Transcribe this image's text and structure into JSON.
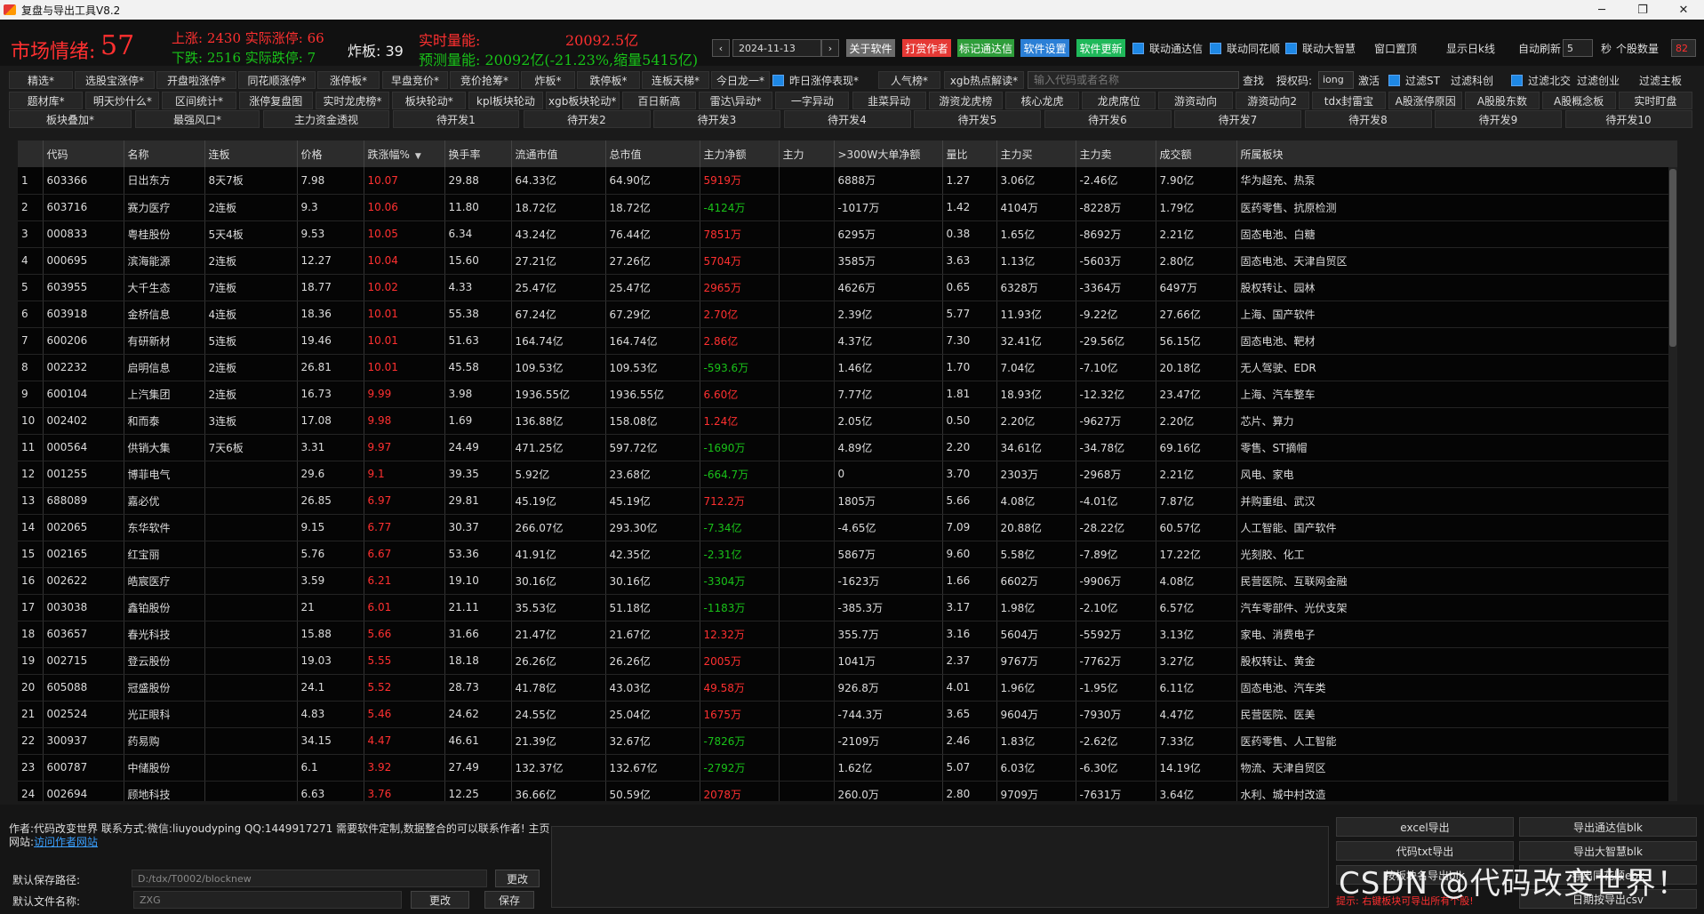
{
  "window": {
    "title": "复盘与导出工具V8.2",
    "controls": [
      "─",
      "❐",
      "✕"
    ]
  },
  "stats": {
    "mood_label": "市场情绪:",
    "mood_value": "57",
    "line1": "上涨: 2430 实际涨停: 66",
    "line2": "下跌: 2516 实际跌停: 7",
    "zhaban": "炸板: 39",
    "realtime_label": "实时量能:",
    "realtime_value": "20092.5亿",
    "predict": "预测量能: 20092亿(-21.23%,缩量5415亿)"
  },
  "topbar": {
    "prev": "‹",
    "next": "›",
    "date": "2024-11-13",
    "buttons": [
      {
        "label": "关于软件",
        "color": "#6b6b6b"
      },
      {
        "label": "打赏作者",
        "color": "#e53935"
      },
      {
        "label": "标记通达信",
        "color": "#2e9d3a"
      },
      {
        "label": "软件设置",
        "color": "#2b7fd6"
      },
      {
        "label": "软件更新",
        "color": "#1fb85a"
      }
    ],
    "checks": [
      {
        "label": "联动通达信",
        "checked": true
      },
      {
        "label": "联动同花顺",
        "checked": true
      },
      {
        "label": "联动大智慧",
        "checked": true
      }
    ],
    "window_top": "窗口置顶",
    "show_kline": "显示日k线",
    "auto_refresh": "自动刷新",
    "seconds": "5",
    "sec_unit": "秒",
    "stock_count_label": "个股数量",
    "stock_count": "82"
  },
  "nav": {
    "row1": [
      "精选*",
      "选股宝涨停*",
      "开盘啦涨停*",
      "同花顺涨停*",
      "涨停板*",
      "早盘竞价*",
      "竞价抢筹*",
      "炸板*",
      "跌停板*",
      "连板天梯*",
      "今日龙一*"
    ],
    "yesterday_check": "昨日涨停表现*",
    "row1b": [
      "人气榜*",
      "xgb热点解读*"
    ],
    "search_placeholder": "输入代码或者名称",
    "search_btn": "查找",
    "auth_label": "授权码:",
    "auth_value": "iong",
    "activate": "激活",
    "filters": [
      {
        "label": "过滤ST",
        "checked": true
      },
      {
        "label": "过滤科创",
        "checked": false
      },
      {
        "label": "过滤北交",
        "checked": true
      },
      {
        "label": "过滤创业",
        "checked": false
      },
      {
        "label": "过滤主板",
        "checked": false
      }
    ],
    "row2": [
      "题材库*",
      "明天炒什么*",
      "区间统计*",
      "涨停复盘图",
      "实时龙虎榜*",
      "板块轮动*",
      "kpl板块轮动",
      "xgb板块轮动*",
      "百日新高",
      "雷达\\异动*",
      "一字异动",
      "韭菜异动",
      "游资龙虎榜",
      "核心龙虎",
      "龙虎席位",
      "游资动向",
      "游资动向2",
      "tdx封雷宝",
      "A股涨停原因",
      "A股股东数",
      "A股概念板",
      "实时盯盘"
    ],
    "row3": [
      "板块叠加*",
      "最强风口*",
      "主力资金透视",
      "待开发1",
      "待开发2",
      "待开发3",
      "待开发4",
      "待开发5",
      "待开发6",
      "待开发7",
      "待开发8",
      "待开发9",
      "待开发10"
    ]
  },
  "table": {
    "columns": [
      "",
      "代码",
      "名称",
      "连板",
      "价格",
      "跌涨幅%",
      "换手率",
      "流通市值",
      "总市值",
      "主力净额",
      "主力",
      ">300W大单净额",
      "量比",
      "主力买",
      "主力卖",
      "成交额",
      "所属板块"
    ],
    "sort_arrow": "▼",
    "rows": [
      [
        "1",
        "603366",
        "日出东方",
        "8天7板",
        "7.98",
        "10.07",
        "29.88",
        "64.33亿",
        "64.90亿",
        "5919万",
        "",
        "6888万",
        "1.27",
        "3.06亿",
        "-2.46亿",
        "7.90亿",
        "华为超充、热泵"
      ],
      [
        "2",
        "603716",
        "赛力医疗",
        "2连板",
        "9.3",
        "10.06",
        "11.80",
        "18.72亿",
        "18.72亿",
        "-4124万",
        "",
        "-1017万",
        "1.42",
        "4104万",
        "-8228万",
        "1.79亿",
        "医药零售、抗原检测"
      ],
      [
        "3",
        "000833",
        "粤桂股份",
        "5天4板",
        "9.53",
        "10.05",
        "6.34",
        "43.24亿",
        "76.44亿",
        "7851万",
        "",
        "6295万",
        "0.38",
        "1.65亿",
        "-8692万",
        "2.21亿",
        "固态电池、白糖"
      ],
      [
        "4",
        "000695",
        "滨海能源",
        "2连板",
        "12.27",
        "10.04",
        "15.60",
        "27.21亿",
        "27.26亿",
        "5704万",
        "",
        "3585万",
        "3.63",
        "1.13亿",
        "-5603万",
        "2.80亿",
        "固态电池、天津自贸区"
      ],
      [
        "5",
        "603955",
        "大千生态",
        "7连板",
        "18.77",
        "10.02",
        "4.33",
        "25.47亿",
        "25.47亿",
        "2965万",
        "",
        "4626万",
        "0.65",
        "6328万",
        "-3364万",
        "6497万",
        "股权转让、园林"
      ],
      [
        "6",
        "603918",
        "金桥信息",
        "4连板",
        "18.36",
        "10.01",
        "55.38",
        "67.24亿",
        "67.29亿",
        "2.70亿",
        "",
        "2.39亿",
        "5.77",
        "11.93亿",
        "-9.22亿",
        "27.66亿",
        "上海、国产软件"
      ],
      [
        "7",
        "600206",
        "有研新材",
        "5连板",
        "19.46",
        "10.01",
        "51.63",
        "164.74亿",
        "164.74亿",
        "2.86亿",
        "",
        "4.37亿",
        "7.30",
        "32.41亿",
        "-29.56亿",
        "56.15亿",
        "固态电池、靶材"
      ],
      [
        "8",
        "002232",
        "启明信息",
        "2连板",
        "26.81",
        "10.01",
        "45.58",
        "109.53亿",
        "109.53亿",
        "-593.6万",
        "",
        "1.46亿",
        "1.70",
        "7.04亿",
        "-7.10亿",
        "20.18亿",
        "无人驾驶、EDR"
      ],
      [
        "9",
        "600104",
        "上汽集团",
        "2连板",
        "16.73",
        "9.99",
        "3.98",
        "1936.55亿",
        "1936.55亿",
        "6.60亿",
        "",
        "7.77亿",
        "1.81",
        "18.93亿",
        "-12.32亿",
        "23.47亿",
        "上海、汽车整车"
      ],
      [
        "10",
        "002402",
        "和而泰",
        "3连板",
        "17.08",
        "9.98",
        "1.69",
        "136.88亿",
        "158.08亿",
        "1.24亿",
        "",
        "2.05亿",
        "0.50",
        "2.20亿",
        "-9627万",
        "2.20亿",
        "芯片、算力"
      ],
      [
        "11",
        "000564",
        "供销大集",
        "7天6板",
        "3.31",
        "9.97",
        "24.49",
        "471.25亿",
        "597.72亿",
        "-1690万",
        "",
        "4.89亿",
        "2.20",
        "34.61亿",
        "-34.78亿",
        "69.16亿",
        "零售、ST摘帽"
      ],
      [
        "12",
        "001255",
        "博菲电气",
        "",
        "29.6",
        "9.1",
        "39.35",
        "5.92亿",
        "23.68亿",
        "-664.7万",
        "",
        "0",
        "3.70",
        "2303万",
        "-2968万",
        "2.21亿",
        "风电、家电"
      ],
      [
        "13",
        "688089",
        "嘉必优",
        "",
        "26.85",
        "6.97",
        "29.81",
        "45.19亿",
        "45.19亿",
        "712.2万",
        "",
        "1805万",
        "5.66",
        "4.08亿",
        "-4.01亿",
        "7.87亿",
        "并购重组、武汉"
      ],
      [
        "14",
        "002065",
        "东华软件",
        "",
        "9.15",
        "6.77",
        "30.37",
        "266.07亿",
        "293.30亿",
        "-7.34亿",
        "",
        "-4.65亿",
        "7.09",
        "20.88亿",
        "-28.22亿",
        "60.57亿",
        "人工智能、国产软件"
      ],
      [
        "15",
        "002165",
        "红宝丽",
        "",
        "5.76",
        "6.67",
        "53.36",
        "41.91亿",
        "42.35亿",
        "-2.31亿",
        "",
        "5867万",
        "9.60",
        "5.58亿",
        "-7.89亿",
        "17.22亿",
        "光刻胶、化工"
      ],
      [
        "16",
        "002622",
        "皓宸医疗",
        "",
        "3.59",
        "6.21",
        "19.10",
        "30.16亿",
        "30.16亿",
        "-3304万",
        "",
        "-1623万",
        "1.66",
        "6602万",
        "-9906万",
        "4.08亿",
        "民营医院、互联网金融"
      ],
      [
        "17",
        "003038",
        "鑫铂股份",
        "",
        "21",
        "6.01",
        "21.11",
        "35.53亿",
        "51.18亿",
        "-1183万",
        "",
        "-385.3万",
        "3.17",
        "1.98亿",
        "-2.10亿",
        "6.57亿",
        "汽车零部件、光伏支架"
      ],
      [
        "18",
        "603657",
        "春光科技",
        "",
        "15.88",
        "5.66",
        "31.66",
        "21.47亿",
        "21.67亿",
        "12.32万",
        "",
        "355.7万",
        "3.16",
        "5604万",
        "-5592万",
        "3.13亿",
        "家电、消费电子"
      ],
      [
        "19",
        "002715",
        "登云股份",
        "",
        "19.03",
        "5.55",
        "18.18",
        "26.26亿",
        "26.26亿",
        "2005万",
        "",
        "1041万",
        "2.37",
        "9767万",
        "-7762万",
        "3.27亿",
        "股权转让、黄金"
      ],
      [
        "20",
        "605088",
        "冠盛股份",
        "",
        "24.1",
        "5.52",
        "28.73",
        "41.78亿",
        "43.03亿",
        "49.58万",
        "",
        "926.8万",
        "4.01",
        "1.96亿",
        "-1.95亿",
        "6.11亿",
        "固态电池、汽车类"
      ],
      [
        "21",
        "002524",
        "光正眼科",
        "",
        "4.83",
        "5.46",
        "24.62",
        "24.55亿",
        "25.04亿",
        "1675万",
        "",
        "-744.3万",
        "3.65",
        "9604万",
        "-7930万",
        "4.47亿",
        "民营医院、医美"
      ],
      [
        "22",
        "300937",
        "药易购",
        "",
        "34.15",
        "4.47",
        "46.61",
        "21.39亿",
        "32.67亿",
        "-7826万",
        "",
        "-2109万",
        "2.46",
        "1.83亿",
        "-2.62亿",
        "7.33亿",
        "医药零售、人工智能"
      ],
      [
        "23",
        "600787",
        "中储股份",
        "",
        "6.1",
        "3.92",
        "27.49",
        "132.37亿",
        "132.67亿",
        "-2792万",
        "",
        "1.62亿",
        "5.07",
        "6.03亿",
        "-6.30亿",
        "14.19亿",
        "物流、天津自贸区"
      ],
      [
        "24",
        "002694",
        "顾地科技",
        "",
        "6.63",
        "3.76",
        "12.25",
        "36.66亿",
        "50.59亿",
        "2078万",
        "",
        "260.0万",
        "2.80",
        "9709万",
        "-7631万",
        "3.64亿",
        "水利、城中村改造"
      ]
    ]
  },
  "bottom": {
    "author_text": "作者:代码改变世界 联系方式:微信:liuyoudyping QQ:1449917271 需要软件定制,数据整合的可以联系作者! 主页网站:",
    "author_link": "访问作者网站",
    "save_path_label": "默认保存路径:",
    "save_path": "D:/tdx/T0002/blocknew",
    "change1": "更改",
    "file_name_label": "默认文件名称:",
    "file_name": "ZXG",
    "change2": "更改",
    "save": "保存",
    "export_left": [
      "excel导出",
      "代码txt导出",
      "按板块名导出blk"
    ],
    "export_right": [
      "导出通达信blk",
      "导出大智慧blk",
      "导出同花顺ebk",
      "日期按导出csv"
    ],
    "tip": "提示: 右键板块可导出所有个股!",
    "watermark": "CSDN @代码改变世界！"
  }
}
